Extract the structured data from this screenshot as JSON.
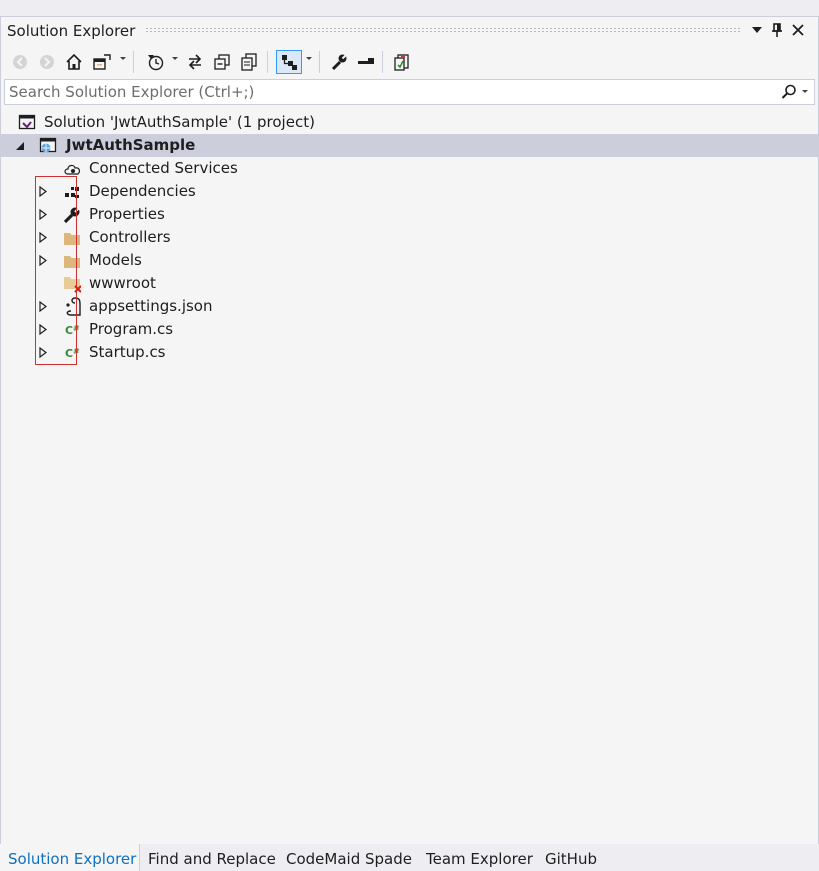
{
  "window": {
    "title": "Solution Explorer"
  },
  "search": {
    "placeholder": "Search Solution Explorer (Ctrl+;)"
  },
  "toolbar": {
    "icons": [
      "back-icon",
      "forward-icon",
      "home-icon",
      "switch-views-icon",
      "pending-changes-filter-icon",
      "sync-icon",
      "collapse-all-icon",
      "show-all-files-icon",
      "preview-selected-icon",
      "properties-icon",
      "minus-icon",
      "sync-with-document-icon"
    ]
  },
  "tree": {
    "solution": "Solution 'JwtAuthSample' (1 project)",
    "project": "JwtAuthSample",
    "items": [
      {
        "label": "Connected Services",
        "icon": "cloud-icon",
        "expandable": false
      },
      {
        "label": "Dependencies",
        "icon": "dependencies-icon",
        "expandable": true
      },
      {
        "label": "Properties",
        "icon": "wrench-icon",
        "expandable": true
      },
      {
        "label": "Controllers",
        "icon": "folder-icon",
        "expandable": true
      },
      {
        "label": "Models",
        "icon": "folder-icon",
        "expandable": true
      },
      {
        "label": "wwwroot",
        "icon": "folder-error-icon",
        "expandable": false
      },
      {
        "label": "appsettings.json",
        "icon": "json-file-icon",
        "expandable": true
      },
      {
        "label": "Program.cs",
        "icon": "csharp-file-icon",
        "expandable": true
      },
      {
        "label": "Startup.cs",
        "icon": "csharp-file-icon",
        "expandable": true
      }
    ]
  },
  "tabs": [
    {
      "label": "Solution Explorer",
      "active": true
    },
    {
      "label": "Find and Replace",
      "active": false
    },
    {
      "label": "CodeMaid Spade",
      "active": false
    },
    {
      "label": "Team Explorer",
      "active": false
    },
    {
      "label": "GitHub",
      "active": false
    }
  ],
  "colors": {
    "accent": "#0e70c0",
    "selection": "#cccedb",
    "folder": "#dcb67a",
    "csharp": "#388a34",
    "highlight_box": "#d03030"
  }
}
